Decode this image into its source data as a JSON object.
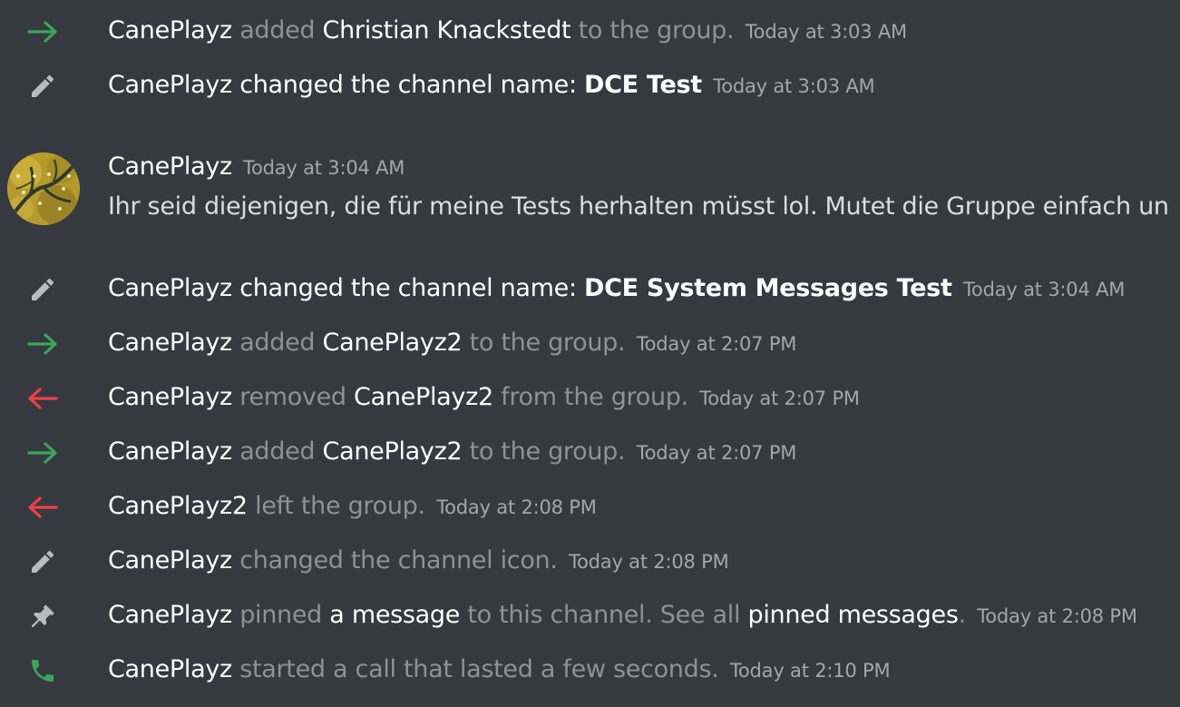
{
  "colors": {
    "background": "#36393f",
    "join_arrow": "#3ba55d",
    "leave_arrow": "#ed4245",
    "pencil_icon": "#b9bbbe",
    "pin_icon": "#b9bbbe",
    "call_icon": "#3ba55d",
    "username": "#ffffff",
    "system_text": "#8e9297",
    "timestamp": "#a3a6aa",
    "message_text": "#dcddde"
  },
  "events": [
    {
      "icon": "arrow-right-icon",
      "actor": "CanePlayz",
      "verb": " added ",
      "target": "Christian Knackstedt",
      "tail": " to the group.",
      "timestamp": "Today at 3:03 AM"
    },
    {
      "icon": "pencil-icon",
      "actor": "CanePlayz",
      "verb": " changed the channel name: ",
      "target": "DCE Test",
      "timestamp": "Today at 3:03 AM"
    },
    {
      "icon": "pencil-icon",
      "actor": "CanePlayz",
      "verb": " changed the channel name: ",
      "target": "DCE System Messages Test",
      "timestamp": "Today at 3:04 AM"
    },
    {
      "icon": "arrow-right-icon",
      "actor": "CanePlayz",
      "verb": " added ",
      "target": "CanePlayz2",
      "tail": " to the group.",
      "timestamp": "Today at 2:07 PM"
    },
    {
      "icon": "arrow-left-icon",
      "actor": "CanePlayz",
      "verb": " removed ",
      "target": "CanePlayz2",
      "tail": " from the group.",
      "timestamp": "Today at 2:07 PM"
    },
    {
      "icon": "arrow-right-icon",
      "actor": "CanePlayz",
      "verb": " added ",
      "target": "CanePlayz2",
      "tail": " to the group.",
      "timestamp": "Today at 2:07 PM"
    },
    {
      "icon": "arrow-left-icon",
      "actor": "CanePlayz2",
      "verb": " left the group.",
      "timestamp": "Today at 2:08 PM"
    },
    {
      "icon": "pencil-icon",
      "actor": "CanePlayz",
      "verb": " changed the channel icon.",
      "timestamp": "Today at 2:08 PM"
    },
    {
      "icon": "pin-icon",
      "actor": "CanePlayz",
      "verb": " pinned ",
      "link1": "a message",
      "mid": " to this channel. See all ",
      "link2": "pinned messages",
      "tail": ".",
      "timestamp": "Today at 2:08 PM"
    },
    {
      "icon": "phone-icon",
      "actor": "CanePlayz",
      "verb": " started a call that lasted a few seconds.",
      "timestamp": "Today at 2:10 PM"
    }
  ],
  "message": {
    "author": "CanePlayz",
    "timestamp": "Today at 3:04 AM",
    "content": "Ihr seid diejenigen, die für meine Tests herhalten müsst lol. Mutet die Gruppe einfach un"
  }
}
